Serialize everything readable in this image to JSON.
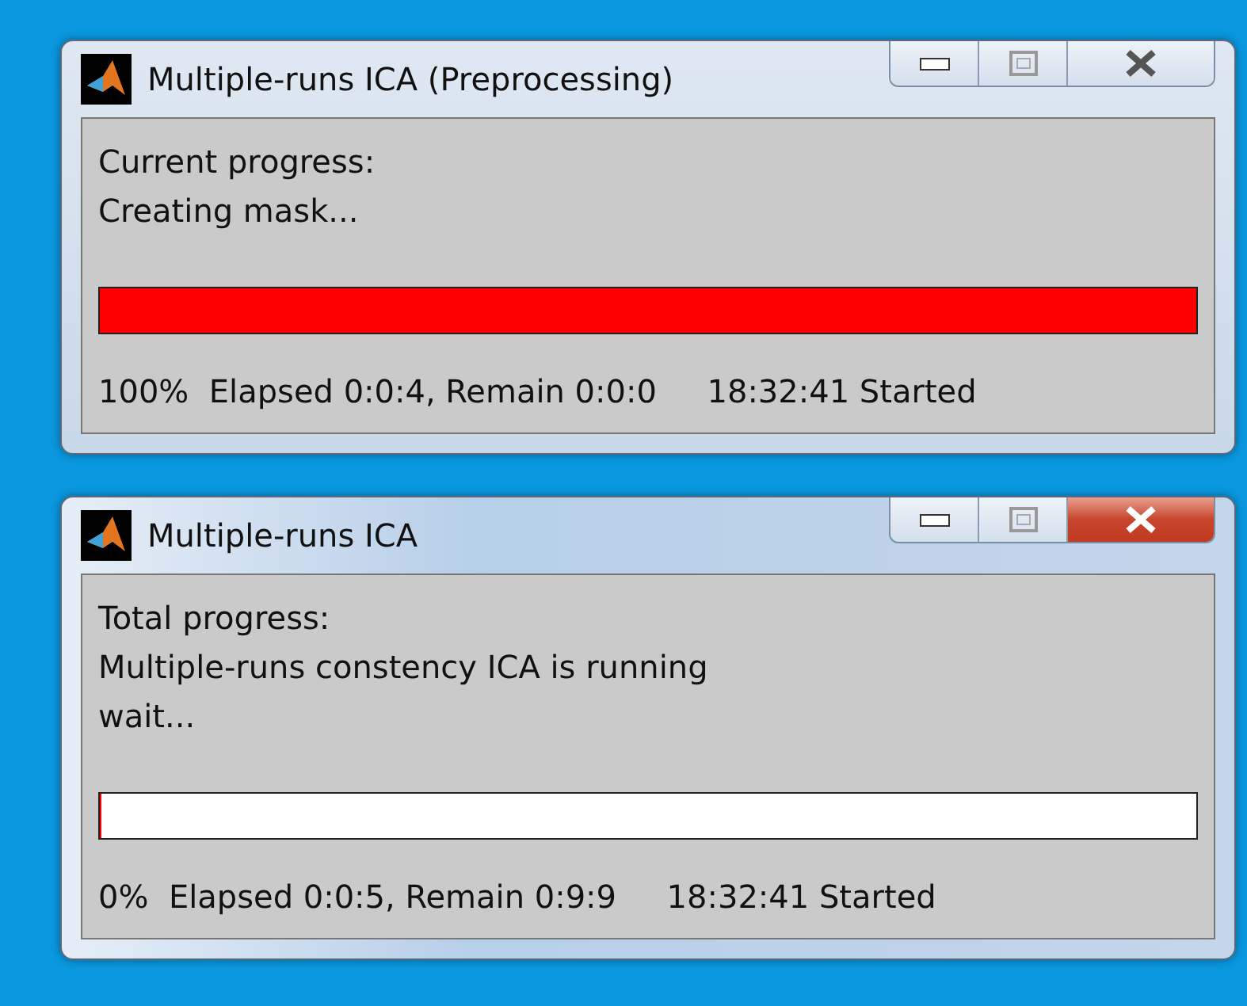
{
  "windows": [
    {
      "title": "Multiple-runs ICA (Preprocessing)",
      "active": false,
      "message_lines": [
        "Current progress:",
        "Creating mask..."
      ],
      "progress": {
        "level": 1
      },
      "status": "100%  Elapsed 0:0:4, Remain 0:0:0     18:32:41 Started"
    },
    {
      "title": "Multiple-runs ICA",
      "active": true,
      "message_lines": [
        "Total progress:",
        "Multiple-runs constency ICA is running",
        "wait..."
      ],
      "progress": {
        "level": 0
      },
      "status": "0%  Elapsed 0:0:5, Remain 0:9:9     18:32:41 Started"
    }
  ]
}
